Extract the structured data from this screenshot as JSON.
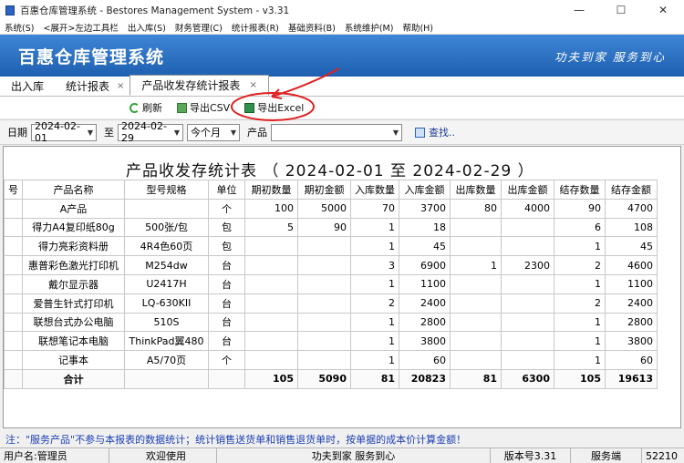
{
  "window": {
    "title": "百惠仓库管理系统 - Bestores Management System - v3.31",
    "minimize": "—",
    "maximize": "☐",
    "close": "✕"
  },
  "menu": [
    "系统(S)",
    "<展开>左边工具栏",
    "出入库(S)",
    "财务管理(C)",
    "统计报表(R)",
    "基础资料(B)",
    "系统维护(M)",
    "帮助(H)"
  ],
  "banner": {
    "title": "百惠仓库管理系统",
    "slogan": "功夫到家 服务到心"
  },
  "tabs": {
    "t1": "出入库",
    "t2": "统计报表",
    "t3": "产品收发存统计报表",
    "close": "×"
  },
  "toolbar": {
    "refresh": "刷新",
    "export_csv": "导出CSV",
    "export_excel": "导出Excel"
  },
  "filters": {
    "date_label": "日期",
    "start_date": "2024-02-01",
    "to_label": "至",
    "end_date": "2024-02-29",
    "period": "今个月",
    "product_label": "产品",
    "product_value": "",
    "search": "查找.."
  },
  "report": {
    "title": "产品收发存统计表  （ 2024-02-01  至  2024-02-29 ）",
    "columns": [
      "号",
      "产品名称",
      "型号规格",
      "单位",
      "期初数量",
      "期初金额",
      "入库数量",
      "入库金额",
      "出库数量",
      "出库金额",
      "结存数量",
      "结存金额"
    ],
    "rows": [
      [
        "",
        "A产品",
        "",
        "个",
        "100",
        "5000",
        "70",
        "3700",
        "80",
        "4000",
        "90",
        "4700"
      ],
      [
        "",
        "得力A4复印纸80g",
        "500张/包",
        "包",
        "5",
        "90",
        "1",
        "18",
        "",
        "",
        "6",
        "108"
      ],
      [
        "",
        "得力亮彩资料册",
        "4R4色60页",
        "包",
        "",
        "",
        "1",
        "45",
        "",
        "",
        "1",
        "45"
      ],
      [
        "",
        "惠普彩色激光打印机",
        "M254dw",
        "台",
        "",
        "",
        "3",
        "6900",
        "1",
        "2300",
        "2",
        "4600"
      ],
      [
        "",
        "戴尔显示器",
        "U2417H",
        "台",
        "",
        "",
        "1",
        "1100",
        "",
        "",
        "1",
        "1100"
      ],
      [
        "",
        "爱普生针式打印机",
        "LQ-630KII",
        "台",
        "",
        "",
        "2",
        "2400",
        "",
        "",
        "2",
        "2400"
      ],
      [
        "",
        "联想台式办公电脑",
        "510S",
        "台",
        "",
        "",
        "1",
        "2800",
        "",
        "",
        "1",
        "2800"
      ],
      [
        "",
        "联想笔记本电脑",
        "ThinkPad翼480",
        "台",
        "",
        "",
        "1",
        "3800",
        "",
        "",
        "1",
        "3800"
      ],
      [
        "",
        "记事本",
        "A5/70页",
        "个",
        "",
        "",
        "1",
        "60",
        "",
        "",
        "1",
        "60"
      ]
    ],
    "total": [
      "",
      "合计",
      "",
      "",
      "105",
      "5090",
      "81",
      "20823",
      "81",
      "6300",
      "105",
      "19613"
    ]
  },
  "note": "注：\"服务产品\"不参与本报表的数据统计；统计销售送货单和销售退货单时，按单据的成本价计算金额！",
  "status": {
    "user": "用户名:管理员",
    "welcome": "欢迎使用",
    "slogan": "功夫到家 服务到心",
    "version": "版本号3.31",
    "service": "服务端",
    "port": "52210"
  },
  "colors": {
    "banner": "#1e5fb0",
    "annotation": "#e02020",
    "note": "#1b3fb5"
  }
}
